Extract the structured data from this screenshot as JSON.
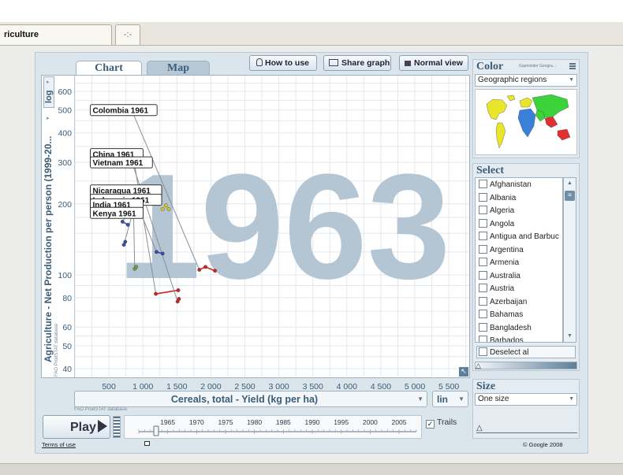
{
  "window_tabs": [
    "riculture",
    "-:-"
  ],
  "chart_tabs": {
    "chart": "Chart",
    "map": "Map"
  },
  "toolbar": {
    "how_to_use": "How to use",
    "share_graph": "Share graph",
    "normal_view": "Normal view"
  },
  "y_scale_mode": "log",
  "x_scale_mode": "lin",
  "source_v": "FAO ProdSTAT database",
  "source_h": "FAO ProdSTAT database",
  "year_display": "1963",
  "play_label": "Play",
  "trails_label": "Trails",
  "trails_checked": true,
  "timeline_years": [
    "1965",
    "1970",
    "1975",
    "1980",
    "1985",
    "1990",
    "1995",
    "2000",
    "2005"
  ],
  "timeline_position_year": 1963,
  "terms": "Terms of use",
  "copyright": "© Google 2008",
  "color_panel": {
    "title": "Color",
    "author": "Gapminder Geogra...",
    "selected": "Geographic regions"
  },
  "select_panel": {
    "title": "Select",
    "items": [
      "Afghanistan",
      "Albania",
      "Algeria",
      "Angola",
      "Antigua and Barbuc",
      "Argentina",
      "Armenia",
      "Australia",
      "Austria",
      "Azerbaijan",
      "Bahamas",
      "Bangladesh",
      "Barbados"
    ],
    "deselect_label": "Deselect al"
  },
  "size_panel": {
    "title": "Size",
    "selected": "One size"
  },
  "colors": {
    "accent": "#3b5d78",
    "year_watermark": "#b4c5d4",
    "africa": "#3a4ea3",
    "americas": "#d02424",
    "asia": "#7d9a3c",
    "europe": "#d8c82e"
  },
  "chart_data": {
    "type": "scatter",
    "title": "",
    "xlabel": "Cereals, total - Yield (kg per ha)",
    "ylabel": "Agriculture - Net Production per person (1999-20...",
    "x_scale": "lin",
    "y_scale": "log",
    "xlim": [
      0,
      5800
    ],
    "ylim": [
      37,
      700
    ],
    "x_ticks": [
      "500",
      "1 000",
      "1 500",
      "2 000",
      "2 500",
      "3 000",
      "3 500",
      "4 000",
      "4 500",
      "5 000",
      "5 500"
    ],
    "x_tick_values": [
      500,
      1000,
      1500,
      2000,
      2500,
      3000,
      3500,
      4000,
      4500,
      5000,
      5500
    ],
    "y_ticks": [
      "40",
      "50",
      "60",
      "80",
      "100",
      "200",
      "300",
      "400",
      "500",
      "600"
    ],
    "y_tick_values": [
      40,
      50,
      60,
      80,
      100,
      200,
      300,
      400,
      500,
      600
    ],
    "grid": true,
    "year": 1963,
    "series": [
      {
        "name": "Colombia 1961",
        "color": "#d02424",
        "label_point": [
          400,
          500
        ],
        "trail": [
          [
            1830,
            105
          ],
          [
            1920,
            108
          ],
          [
            2060,
            104
          ]
        ]
      },
      {
        "name": "China 1961",
        "color": "#d02424",
        "label_point": [
          400,
          325
        ],
        "trail": [
          [
            1190,
            83
          ],
          [
            1520,
            86
          ]
        ]
      },
      {
        "name": "Vietnam 1961",
        "color": "#d02424",
        "label_point": [
          400,
          300
        ],
        "trail": [
          [
            1510,
            77
          ],
          [
            1530,
            79
          ]
        ]
      },
      {
        "name": "Nicaragua 1961",
        "color": "#3a4ea3",
        "label_point": [
          400,
          228
        ],
        "trail": [
          [
            1200,
            125
          ],
          [
            1290,
            123
          ]
        ]
      },
      {
        "name": "Indonesia 1961",
        "color": "#3a4ea3",
        "label_point": [
          400,
          208
        ],
        "trail": [
          [
            700,
            168
          ],
          [
            780,
            163
          ]
        ]
      },
      {
        "name": "India 1961",
        "color": "#3a4ea3",
        "label_point": [
          400,
          199
        ],
        "trail": [
          [
            720,
            134
          ],
          [
            740,
            138
          ]
        ]
      },
      {
        "name": "Kenya 1961",
        "color": "#7d9a3c",
        "label_point": [
          400,
          183
        ],
        "trail": [
          [
            880,
            106
          ],
          [
            900,
            108
          ]
        ]
      },
      {
        "name": "",
        "color": "#d8c82e",
        "label_point": null,
        "trail": [
          [
            1290,
            190
          ],
          [
            1340,
            197
          ],
          [
            1380,
            190
          ]
        ]
      }
    ]
  }
}
